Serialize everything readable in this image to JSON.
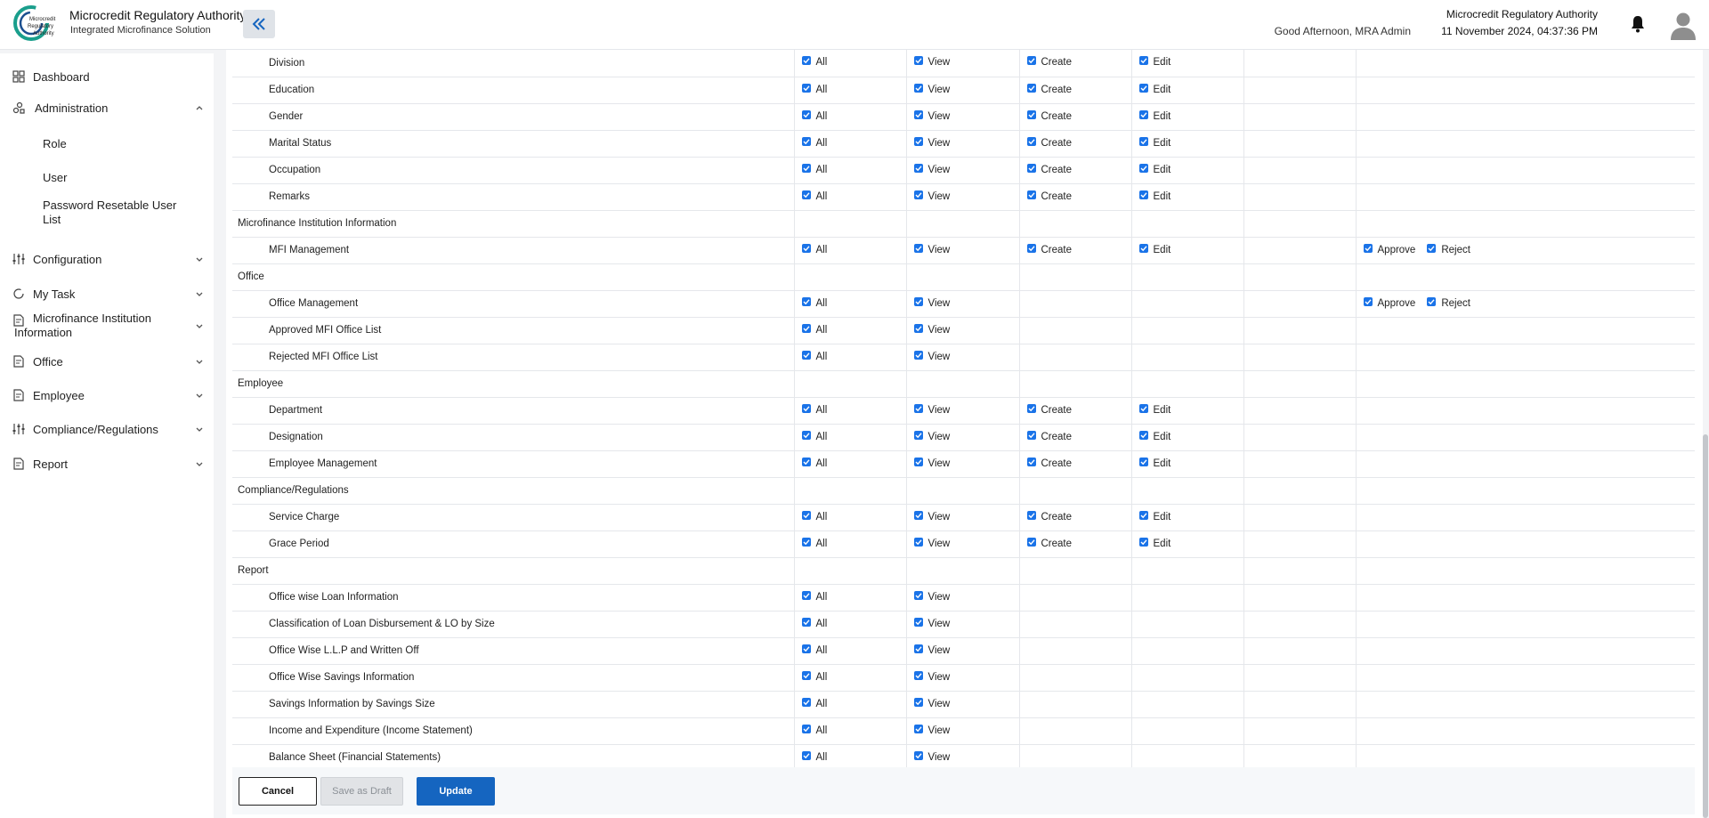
{
  "header": {
    "brand_title": "Microcredit Regulatory Authority",
    "brand_subtitle": "Integrated Microfinance Solution",
    "logo_text": [
      "Microcredit",
      "Regulatory",
      "Authority"
    ],
    "greeting": "Good Afternoon, MRA Admin",
    "org_name": "Microcredit Regulatory Authority",
    "datetime": "11 November 2024, 04:37:36 PM"
  },
  "sidebar": {
    "dashboard": "Dashboard",
    "administration": "Administration",
    "admin_items": [
      "Role",
      "User",
      "Password Resetable User List"
    ],
    "configuration": "Configuration",
    "my_task": "My Task",
    "mfi_info": "Microfinance Institution Information",
    "office": "Office",
    "employee": "Employee",
    "compliance": "Compliance/Regulations",
    "report": "Report"
  },
  "table": {
    "rows": [
      {
        "label": "Division",
        "type": "item",
        "perms": [
          [
            "All"
          ],
          [
            "View"
          ],
          [
            "Create"
          ],
          [
            "Edit"
          ],
          [],
          []
        ]
      },
      {
        "label": "Education",
        "type": "item",
        "perms": [
          [
            "All"
          ],
          [
            "View"
          ],
          [
            "Create"
          ],
          [
            "Edit"
          ],
          [],
          []
        ]
      },
      {
        "label": "Gender",
        "type": "item",
        "perms": [
          [
            "All"
          ],
          [
            "View"
          ],
          [
            "Create"
          ],
          [
            "Edit"
          ],
          [],
          []
        ]
      },
      {
        "label": "Marital Status",
        "type": "item",
        "perms": [
          [
            "All"
          ],
          [
            "View"
          ],
          [
            "Create"
          ],
          [
            "Edit"
          ],
          [],
          []
        ]
      },
      {
        "label": "Occupation",
        "type": "item",
        "perms": [
          [
            "All"
          ],
          [
            "View"
          ],
          [
            "Create"
          ],
          [
            "Edit"
          ],
          [],
          []
        ]
      },
      {
        "label": "Remarks",
        "type": "item",
        "perms": [
          [
            "All"
          ],
          [
            "View"
          ],
          [
            "Create"
          ],
          [
            "Edit"
          ],
          [],
          []
        ]
      },
      {
        "label": "Microfinance Institution Information",
        "type": "group",
        "perms": [
          [],
          [],
          [],
          [],
          [],
          []
        ]
      },
      {
        "label": "MFI Management",
        "type": "item",
        "perms": [
          [
            "All"
          ],
          [
            "View"
          ],
          [
            "Create"
          ],
          [
            "Edit"
          ],
          [],
          [
            "Approve",
            "Reject"
          ]
        ]
      },
      {
        "label": "Office",
        "type": "group",
        "perms": [
          [],
          [],
          [],
          [],
          [],
          []
        ]
      },
      {
        "label": "Office Management",
        "type": "item",
        "perms": [
          [
            "All"
          ],
          [
            "View"
          ],
          [],
          [],
          [],
          [
            "Approve",
            "Reject"
          ]
        ]
      },
      {
        "label": "Approved MFI Office List",
        "type": "item",
        "perms": [
          [
            "All"
          ],
          [
            "View"
          ],
          [],
          [],
          [],
          []
        ]
      },
      {
        "label": "Rejected MFI Office List",
        "type": "item",
        "perms": [
          [
            "All"
          ],
          [
            "View"
          ],
          [],
          [],
          [],
          []
        ]
      },
      {
        "label": "Employee",
        "type": "group",
        "perms": [
          [],
          [],
          [],
          [],
          [],
          []
        ]
      },
      {
        "label": "Department",
        "type": "item",
        "perms": [
          [
            "All"
          ],
          [
            "View"
          ],
          [
            "Create"
          ],
          [
            "Edit"
          ],
          [],
          []
        ]
      },
      {
        "label": "Designation",
        "type": "item",
        "perms": [
          [
            "All"
          ],
          [
            "View"
          ],
          [
            "Create"
          ],
          [
            "Edit"
          ],
          [],
          []
        ]
      },
      {
        "label": "Employee Management",
        "type": "item",
        "perms": [
          [
            "All"
          ],
          [
            "View"
          ],
          [
            "Create"
          ],
          [
            "Edit"
          ],
          [],
          []
        ]
      },
      {
        "label": "Compliance/Regulations",
        "type": "group",
        "perms": [
          [],
          [],
          [],
          [],
          [],
          []
        ]
      },
      {
        "label": "Service Charge",
        "type": "item",
        "perms": [
          [
            "All"
          ],
          [
            "View"
          ],
          [
            "Create"
          ],
          [
            "Edit"
          ],
          [],
          []
        ]
      },
      {
        "label": "Grace Period",
        "type": "item",
        "perms": [
          [
            "All"
          ],
          [
            "View"
          ],
          [
            "Create"
          ],
          [
            "Edit"
          ],
          [],
          []
        ]
      },
      {
        "label": "Report",
        "type": "group",
        "perms": [
          [],
          [],
          [],
          [],
          [],
          []
        ]
      },
      {
        "label": "Office wise Loan Information",
        "type": "item",
        "perms": [
          [
            "All"
          ],
          [
            "View"
          ],
          [],
          [],
          [],
          []
        ]
      },
      {
        "label": "Classification of Loan Disbursement & LO by Size",
        "type": "item",
        "perms": [
          [
            "All"
          ],
          [
            "View"
          ],
          [],
          [],
          [],
          []
        ]
      },
      {
        "label": "Office Wise L.L.P and Written Off",
        "type": "item",
        "perms": [
          [
            "All"
          ],
          [
            "View"
          ],
          [],
          [],
          [],
          []
        ]
      },
      {
        "label": "Office Wise Savings Information",
        "type": "item",
        "perms": [
          [
            "All"
          ],
          [
            "View"
          ],
          [],
          [],
          [],
          []
        ]
      },
      {
        "label": "Savings Information by Savings Size",
        "type": "item",
        "perms": [
          [
            "All"
          ],
          [
            "View"
          ],
          [],
          [],
          [],
          []
        ]
      },
      {
        "label": "Income and Expenditure (Income Statement)",
        "type": "item",
        "perms": [
          [
            "All"
          ],
          [
            "View"
          ],
          [],
          [],
          [],
          []
        ]
      },
      {
        "label": "Balance Sheet (Financial Statements)",
        "type": "item",
        "perms": [
          [
            "All"
          ],
          [
            "View"
          ],
          [],
          [],
          [],
          []
        ]
      }
    ]
  },
  "footer": {
    "cancel": "Cancel",
    "save_draft": "Save as Draft",
    "update": "Update"
  },
  "colors": {
    "primary": "#1565c0",
    "checkbox": "#1a73e8",
    "logo_green": "#1a9e8c"
  }
}
